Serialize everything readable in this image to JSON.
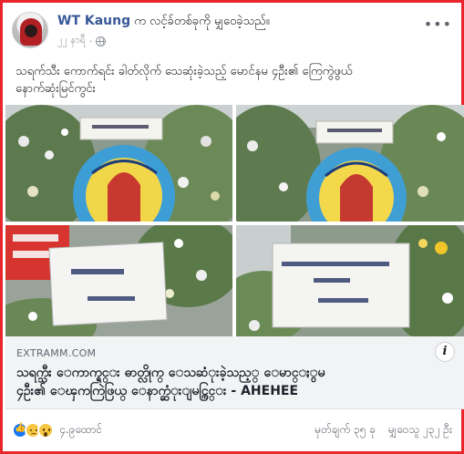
{
  "post": {
    "author": "WT Kaung",
    "action": " က လင့်ခ်တစ်ခုကို မျှဝေခဲ့သည်။",
    "time": "၂၂ နာရီ",
    "menu_icon": "more-icon",
    "privacy_icon": "globe-icon",
    "text_line1": "သရက်သီး ကောက်ရင်း ခါတ်လိုက် သေဆုံးခဲ့သည့် မောင်နမ ၄ဦး၏ ကြေကွဲဖွယ်",
    "text_line2": "နောက်ဆုံးမြင်ကွင်း"
  },
  "photos": [
    {
      "alt": "wreath-photo-1"
    },
    {
      "alt": "wreath-photo-2"
    },
    {
      "alt": "wreath-photo-3"
    },
    {
      "alt": "wreath-photo-4"
    }
  ],
  "link": {
    "domain": "EXTRAMM.COM",
    "title_line1": "သရက္သီး ေကာက္ရင္း ဓာတ္လိုက္ ေသဆံုးခဲ့သည့္ ေမာင္ႏွမ",
    "title_line2": "၄ဦး၏ ေၾကကြဲဖြယ္ ေနာက္ဆံုးျမင္ကြင္း - AHEHEE",
    "info_icon": "info-icon"
  },
  "footer": {
    "reaction_icons": [
      "like-icon",
      "sad-icon",
      "wow-icon"
    ],
    "reaction_count": "၄.၉ထောင်",
    "comments": "မှတ်ချက် ၃၅ ခု",
    "shares": "မျှဝေသူ ၂၃၂ ဦး"
  },
  "colors": {
    "border": "#e8262b",
    "author": "#385898",
    "link_bg": "#f2f3f5"
  }
}
